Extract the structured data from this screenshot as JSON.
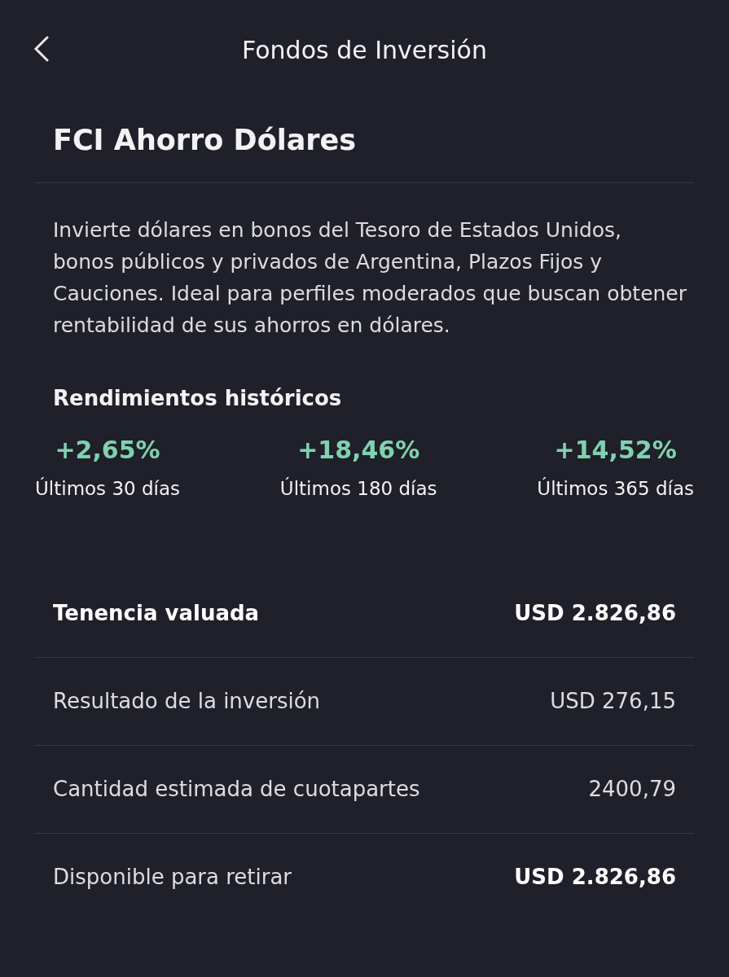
{
  "header": {
    "title": "Fondos de Inversión"
  },
  "fund": {
    "name": "FCI Ahorro Dólares",
    "description": "Invierte dólares en bonos del Tesoro de Estados Unidos, bonos públicos y privados de Argentina, Plazos Fijos y Cauciones. Ideal para perfiles moderados que buscan obtener rentabilidad de sus ahorros en dólares."
  },
  "returns": {
    "title": "Rendimientos históricos",
    "items": [
      {
        "value": "+2,65%",
        "label": "Últimos 30 días"
      },
      {
        "value": "+18,46%",
        "label": "Últimos 180 días"
      },
      {
        "value": "+14,52%",
        "label": "Últimos 365 días"
      }
    ]
  },
  "details": [
    {
      "label": "Tenencia valuada",
      "value": "USD 2.826,86",
      "label_bold": true,
      "value_bold": true
    },
    {
      "label": "Resultado de la inversión",
      "value": "USD 276,15",
      "label_bold": false,
      "value_bold": false
    },
    {
      "label": "Cantidad estimada de cuotapartes",
      "value": "2400,79",
      "label_bold": false,
      "value_bold": false
    },
    {
      "label": "Disponible para retirar",
      "value": "USD 2.826,86",
      "label_bold": false,
      "value_bold": true
    }
  ]
}
